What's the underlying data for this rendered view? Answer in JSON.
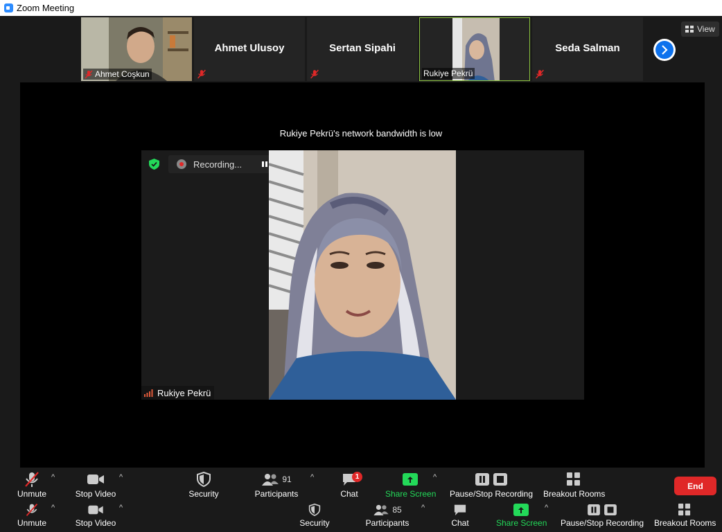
{
  "window": {
    "title": "Zoom Meeting",
    "icon": "zoom-icon"
  },
  "strip": {
    "tiles": [
      {
        "name": "Ahmet Coşkun",
        "type": "video",
        "muted": true
      },
      {
        "name": "Ahmet Ulusoy",
        "type": "name",
        "muted": true
      },
      {
        "name": "Sertan Sipahi",
        "type": "name",
        "muted": true
      },
      {
        "name": "Rukiye Pekrü",
        "type": "video",
        "muted": false,
        "active": true
      },
      {
        "name": "Seda Salman",
        "type": "name",
        "muted": true
      }
    ],
    "next_icon": "chevron-right-icon",
    "view_label": "View",
    "active_border_color": "#8dc63f"
  },
  "stage": {
    "bandwidth_notice": "Rukiye Pekrü's network bandwidth is low",
    "recording_label": "Recording...",
    "speaker_name": "Rukiye Pekrü"
  },
  "toolbar": {
    "unmute": "Unmute",
    "stop_video": "Stop Video",
    "security": "Security",
    "participants": "Participants",
    "participants_count": "91",
    "chat": "Chat",
    "chat_badge": "1",
    "share_screen": "Share Screen",
    "pause_stop_recording": "Pause/Stop Recording",
    "breakout_rooms": "Breakout Rooms",
    "end": "End",
    "share_color": "#23d959",
    "end_color": "#e02828"
  },
  "toolbar_ghost": {
    "unmute": "Unmute",
    "stop_video": "Stop Video",
    "security": "Security",
    "participants": "Participants",
    "participants_count": "85",
    "chat": "Chat",
    "share_screen": "Share Screen",
    "pause_stop_recording": "Pause/Stop Recording",
    "breakout_rooms": "Breakout Rooms"
  }
}
